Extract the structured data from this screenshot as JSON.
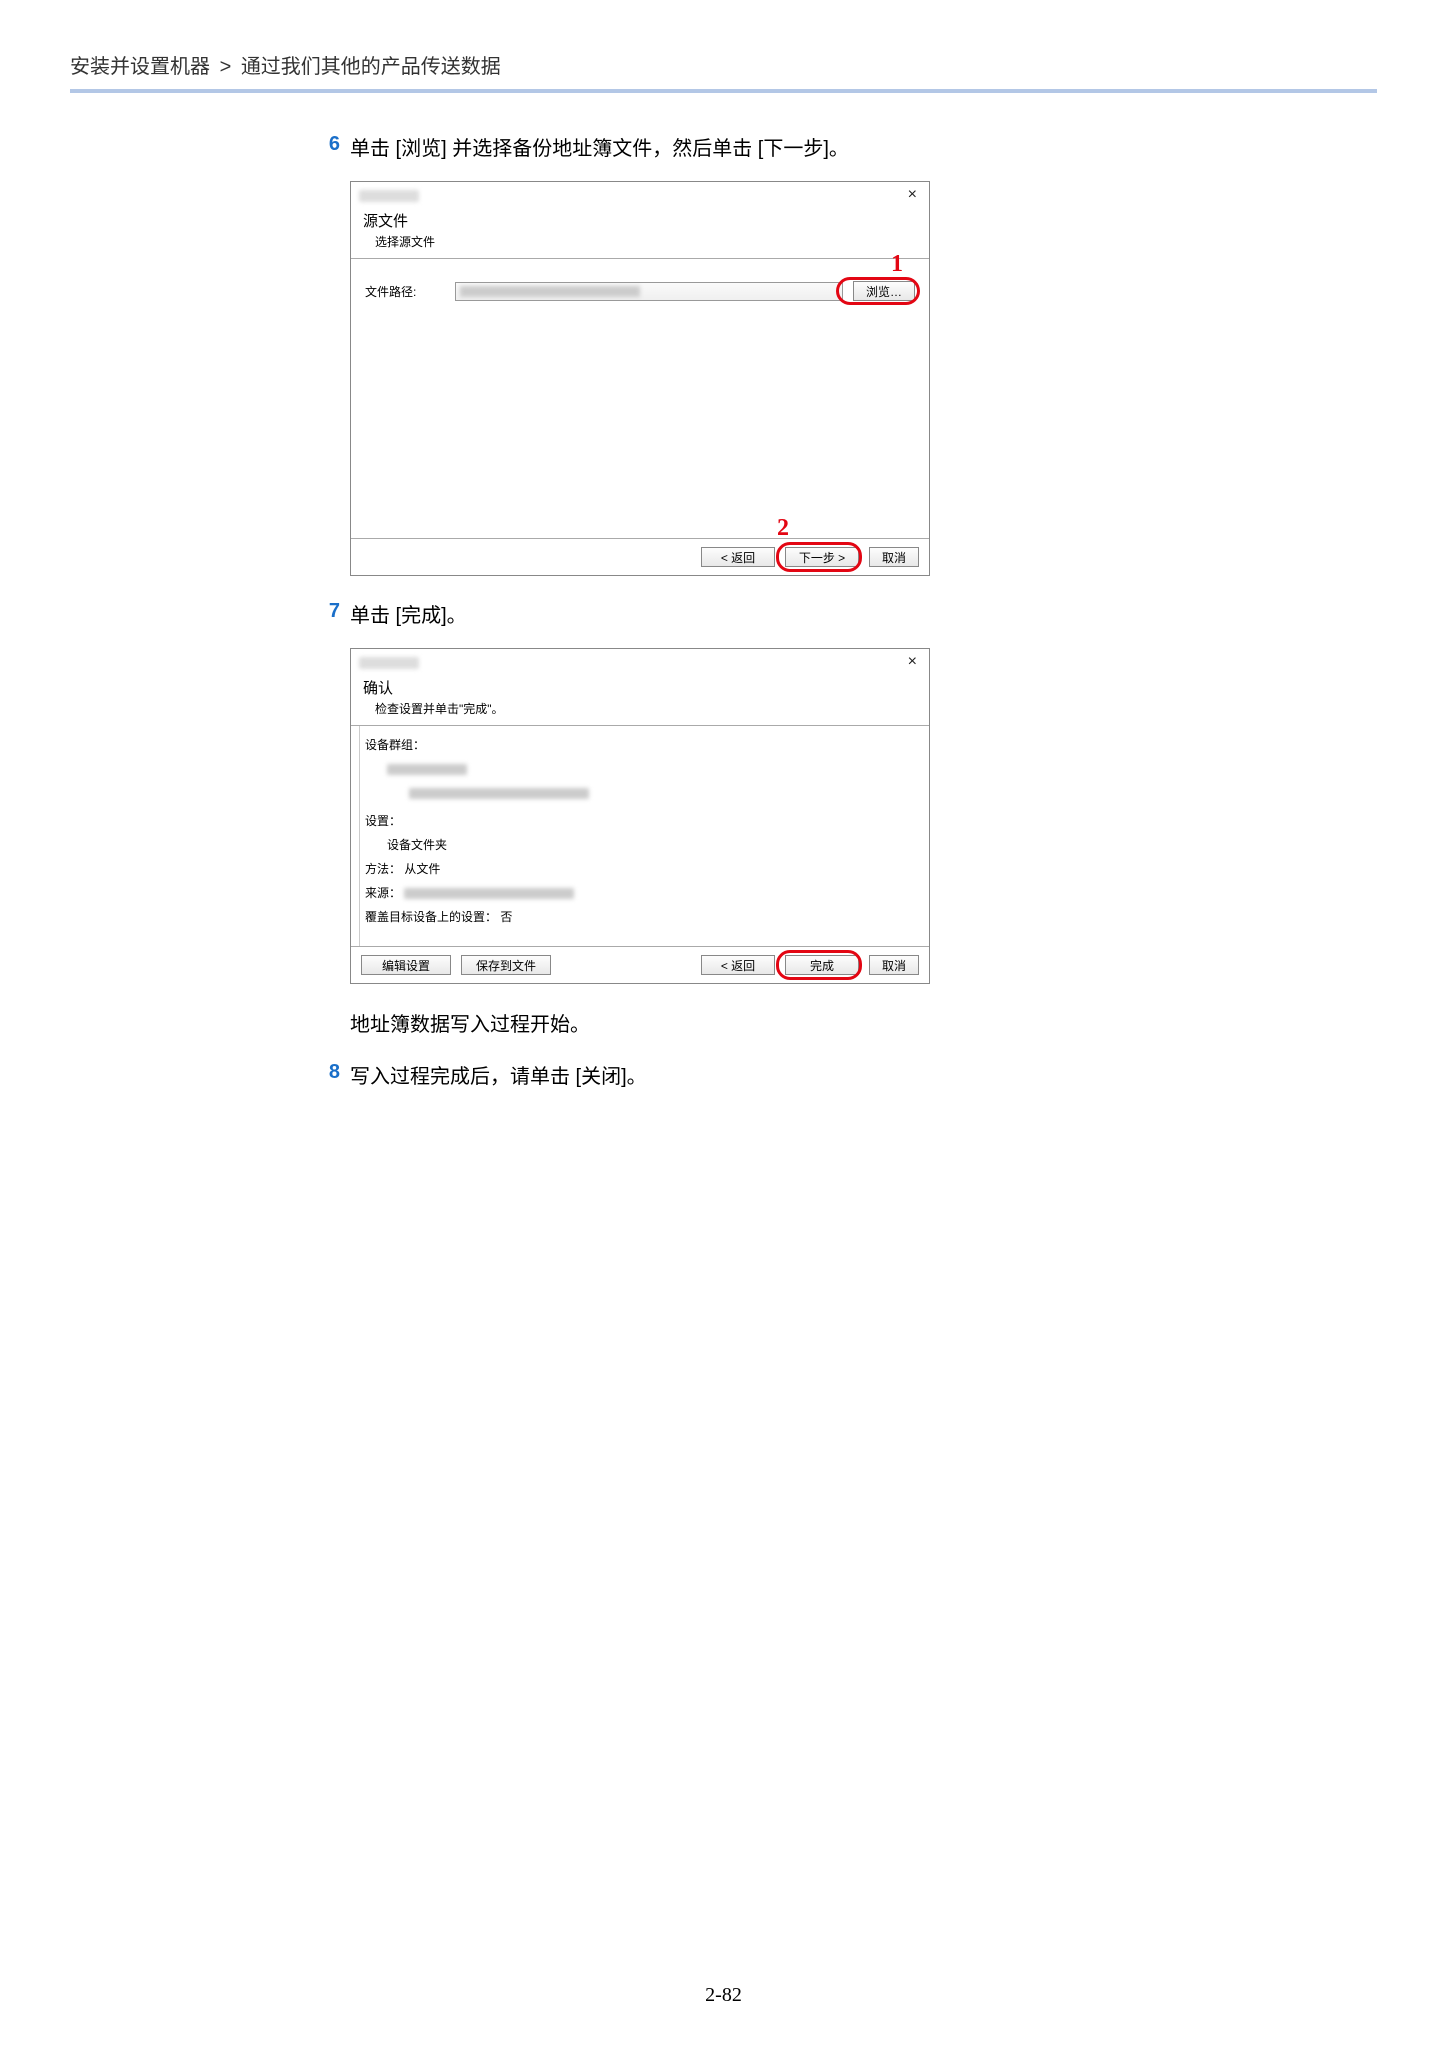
{
  "breadcrumb": {
    "part1": "安装并设置机器",
    "sep": ">",
    "part2": "通过我们其他的产品传送数据"
  },
  "steps": {
    "s6": {
      "num": "6",
      "text": "单击 [浏览] 并选择备份地址簿文件，然后单击 [下一步]。"
    },
    "s7": {
      "num": "7",
      "text": "单击 [完成]。"
    },
    "s7_sub": "地址簿数据写入过程开始。",
    "s8": {
      "num": "8",
      "text": "写入过程完成后，请单击 [关闭]。"
    }
  },
  "dialog1": {
    "close": "×",
    "h1": "源文件",
    "h2": "选择源文件",
    "filepath_label": "文件路径:",
    "browse": "浏览…",
    "back": "< 返回",
    "next": "下一步 >",
    "cancel": "取消",
    "callout1": "1",
    "callout2": "2"
  },
  "dialog2": {
    "close": "×",
    "h1": "确认",
    "h2": "检查设置并单击\"完成\"。",
    "rows": {
      "devgroup_k": "设备群组：",
      "settings_k": "设置：",
      "settings_v": "设备文件夹",
      "method_k": "方法：",
      "method_v": "从文件",
      "source_k": "来源：",
      "overwrite_k": "覆盖目标设备上的设置：",
      "overwrite_v": "否"
    },
    "footer": {
      "edit": "编辑设置",
      "save": "保存到文件",
      "back": "< 返回",
      "finish": "完成",
      "cancel": "取消"
    }
  },
  "page_number": "2-82"
}
